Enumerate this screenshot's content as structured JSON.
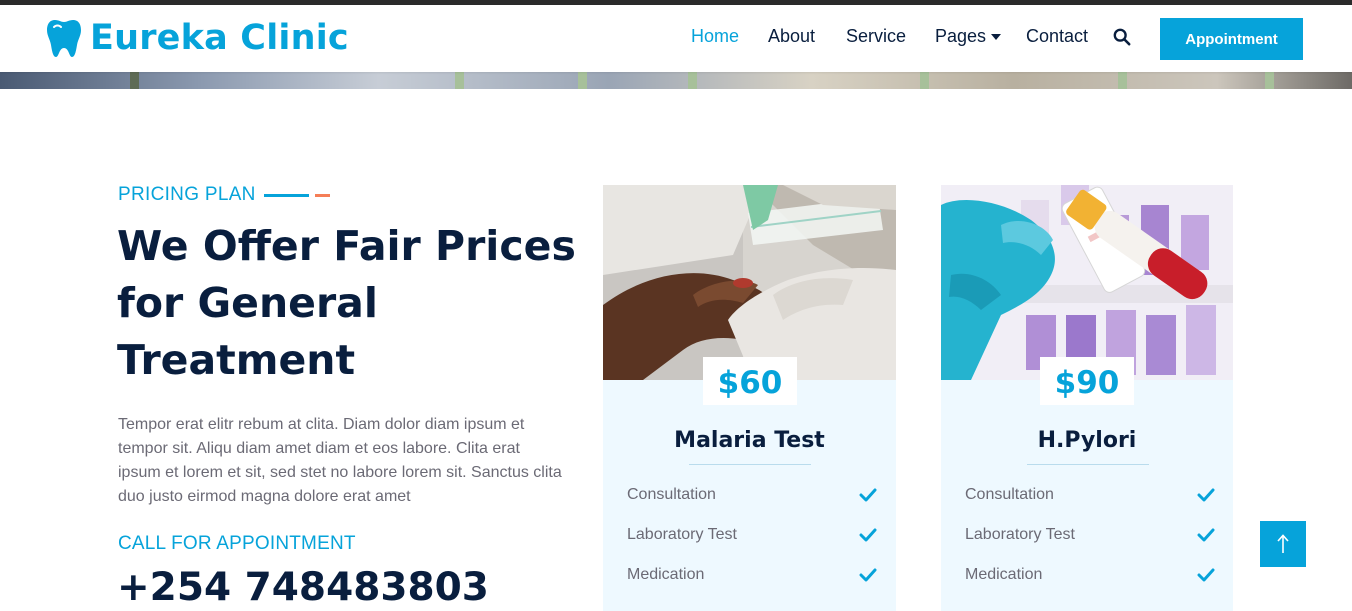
{
  "brand": {
    "name": "Eureka Clinic",
    "icon": "tooth-icon",
    "color": "#06a3da"
  },
  "nav": {
    "items": [
      {
        "label": "Home",
        "active": true
      },
      {
        "label": "About",
        "active": false
      },
      {
        "label": "Service",
        "active": false
      },
      {
        "label": "Pages",
        "active": false,
        "dropdown": true
      },
      {
        "label": "Contact",
        "active": false
      }
    ],
    "search_icon": "search-icon",
    "appointment_label": "Appointment"
  },
  "pricing": {
    "subtitle": "PRICING PLAN",
    "title": "We Offer Fair Prices for General Treatment",
    "description": "Tempor erat elitr rebum at clita. Diam dolor diam ipsum et tempor sit. Aliqu diam amet diam et eos labore. Clita erat ipsum et lorem et sit, sed stet no labore lorem sit. Sanctus clita duo justo eirmod magna dolore erat amet",
    "call_label": "CALL FOR APPOINTMENT",
    "phone": "+254 748483803"
  },
  "plans": [
    {
      "price": "$60",
      "name": "Malaria Test",
      "image": "malaria-test-photo",
      "features": [
        "Consultation",
        "Laboratory Test",
        "Medication"
      ]
    },
    {
      "price": "$90",
      "name": "H.Pylori",
      "image": "h-pylori-test-photo",
      "features": [
        "Consultation",
        "Laboratory Test",
        "Medication"
      ]
    }
  ],
  "back_to_top_icon": "arrow-up-icon",
  "colors": {
    "primary": "#06a3da",
    "dark": "#091e3e",
    "accent": "#f57e57",
    "card_bg": "#eef9ff",
    "text_muted": "#6b6a75"
  }
}
